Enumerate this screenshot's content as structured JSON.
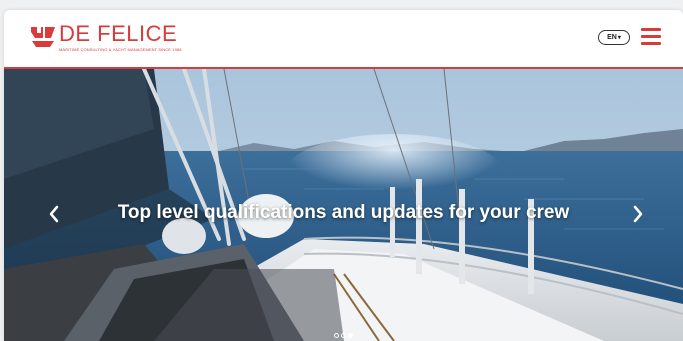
{
  "header": {
    "logo_name": "DE FELICE",
    "logo_tagline": "MARITIME CONSULTING & YACHT MANAGEMENT SINCE 1988",
    "language": "EN",
    "accent_color": "#d93a3a"
  },
  "hero": {
    "headline": "Top level qualifications and updates for your crew",
    "prev_icon": "chevron-left-icon",
    "next_icon": "chevron-right-icon",
    "slides": 3,
    "active_slide": 3
  }
}
